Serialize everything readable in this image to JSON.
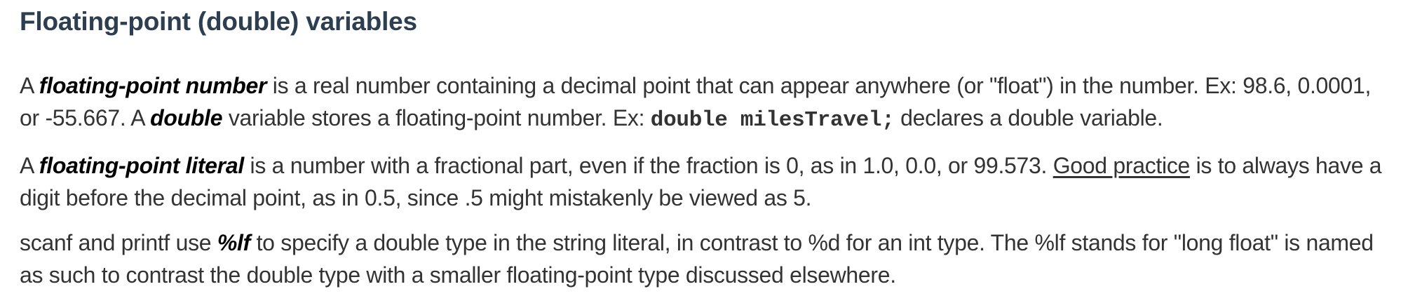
{
  "heading": "Floating-point (double) variables",
  "para1": {
    "t1": "A ",
    "term1": "floating-point number",
    "t2": " is a real number containing a decimal point that can appear anywhere (or \"float\") in the number. Ex: 98.6, 0.0001, or -55.667. A ",
    "term2": "double",
    "t3": " variable stores a floating-point number. Ex: ",
    "code": "double milesTravel;",
    "t4": " declares a double variable."
  },
  "para2": {
    "t1": "A ",
    "term1": "floating-point literal",
    "t2": " is a number with a fractional part, even if the fraction is 0, as in 1.0, 0.0, or 99.573. ",
    "link": "Good practice",
    "t3": " is to always have a digit before the decimal point, as in 0.5, since .5 might mistakenly be viewed as 5."
  },
  "para3": {
    "t1": "scanf and printf use ",
    "term1": "%lf",
    "t2": " to specify a double type in the string literal, in contrast to %d for an int type. The %lf stands for \"long float\" is named as such to contrast the double type with a smaller floating-point type discussed elsewhere."
  }
}
